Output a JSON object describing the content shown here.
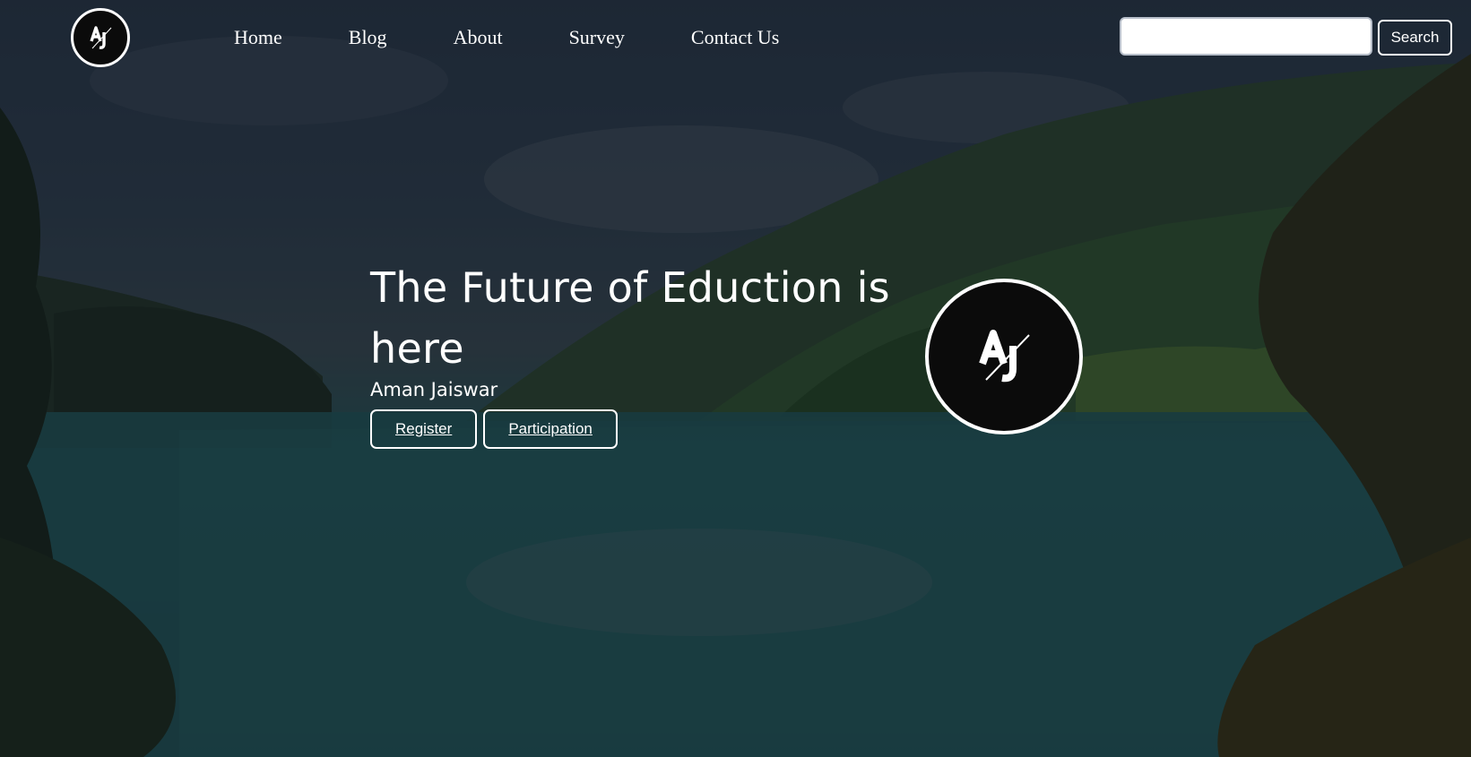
{
  "nav": {
    "logo_text": "AJ",
    "links": [
      "Home",
      "Blog",
      "About",
      "Survey",
      "Contact Us"
    ],
    "search_placeholder": "",
    "search_value": "",
    "search_button": "Search"
  },
  "hero": {
    "title": "The Future of Eduction is here",
    "subtitle": "Aman Jaiswar",
    "buttons": [
      "Register",
      "Participation"
    ],
    "logo_text": "AJ"
  },
  "colors": {
    "overlay": "#0a0e16",
    "accent": "#ffffff",
    "logo_bg": "#0b0b0b"
  }
}
